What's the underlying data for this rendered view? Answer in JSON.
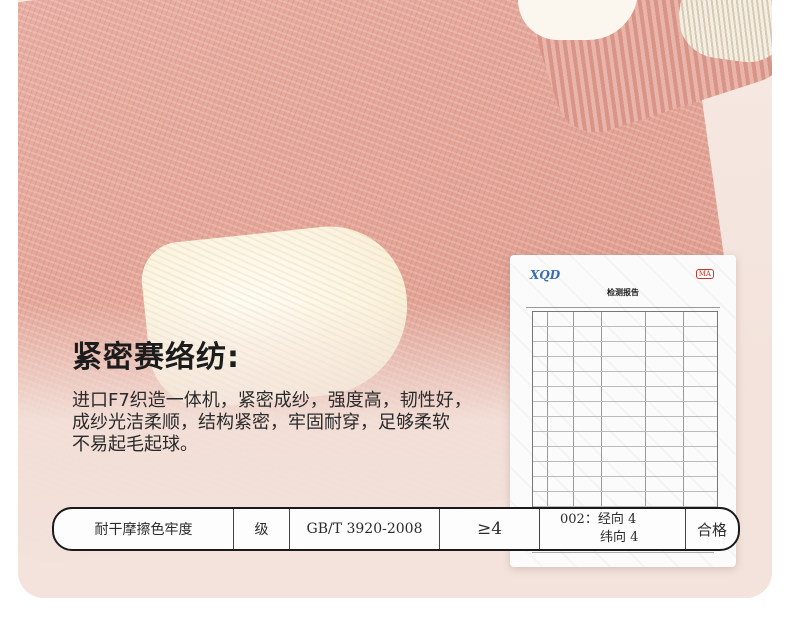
{
  "feature": {
    "headline": "紧密赛络纺:",
    "description_lines": [
      "进口F7织造一体机，紧密成纱，强度高，韧性好，",
      "成纱光洁柔顺，结构紧密，牢固耐穿，足够柔软",
      "不易起毛起球。"
    ]
  },
  "report": {
    "logo": "XQD",
    "mark": "MA",
    "title": "检测报告"
  },
  "result_strip": {
    "item": "耐干摩擦色牢度",
    "unit": "级",
    "standard": "GB/T  3920-2008",
    "requirement": "≥4",
    "result_line1": "002：经向  4",
    "result_line2": "纬向 4",
    "verdict": "合格"
  },
  "colors": {
    "sock_pink": "#e4a597",
    "background": "#f3e3dc",
    "text": "#1c1c1c"
  }
}
